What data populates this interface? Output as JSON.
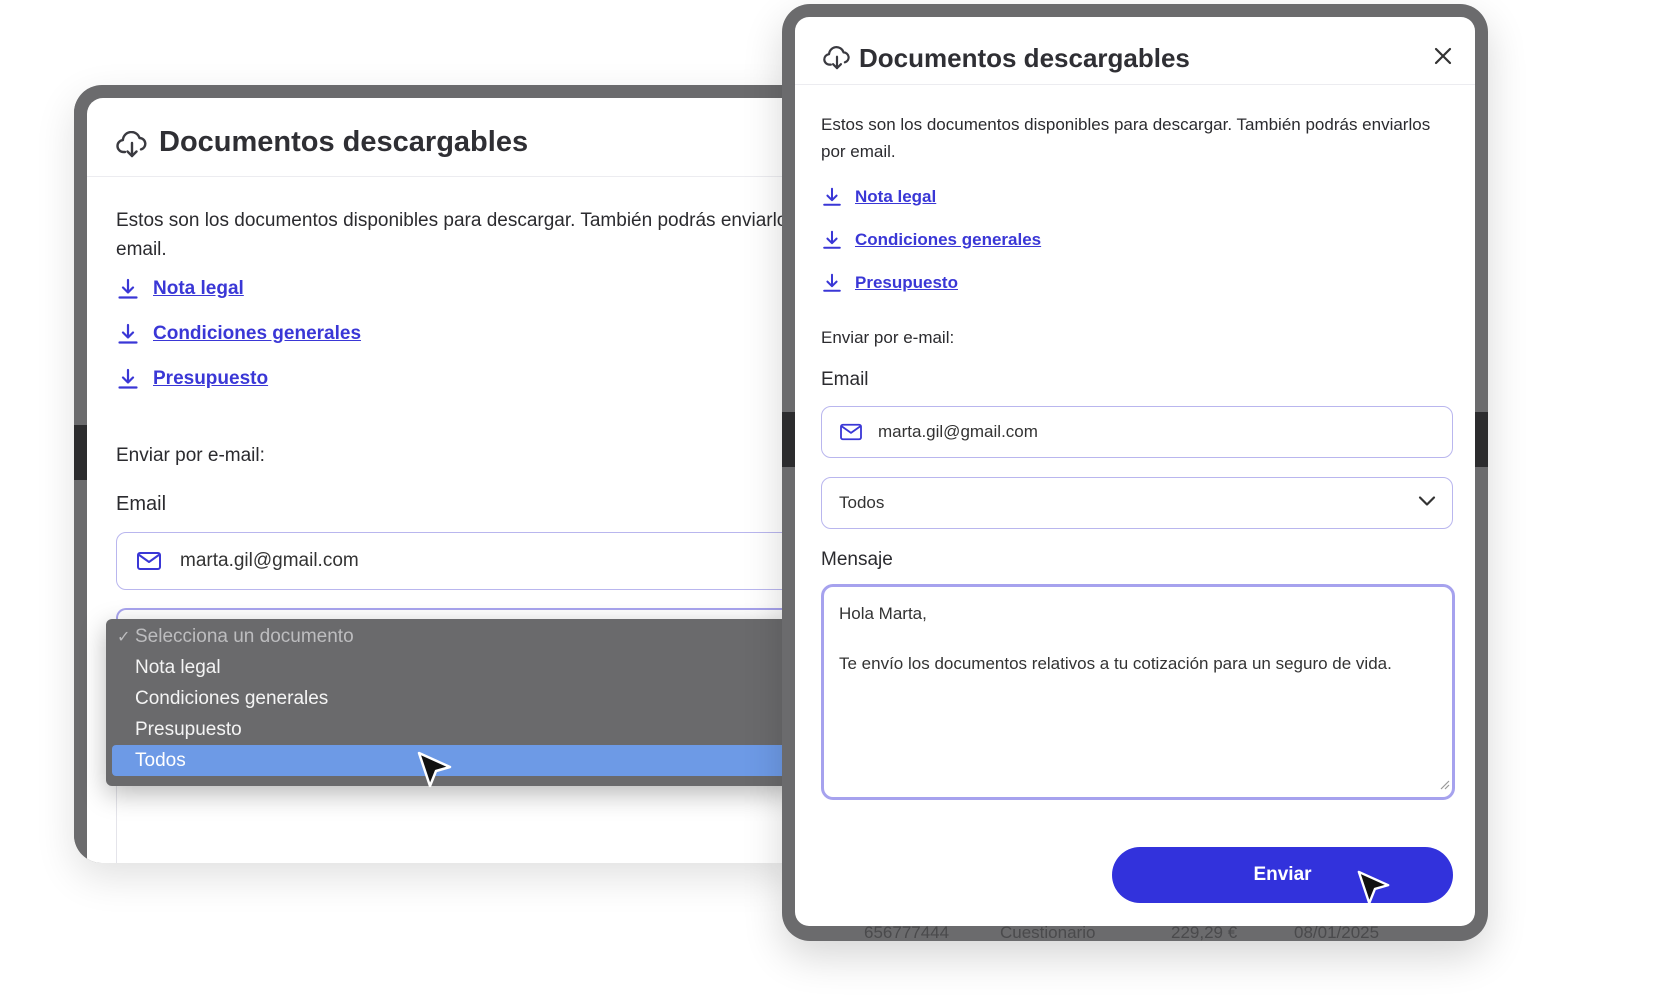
{
  "colors": {
    "accent": "#3232dc",
    "link": "#3a37d6",
    "input_border": "#b9b6ee",
    "dropdown_bg": "#6a6a6c",
    "dropdown_selected": "#6d9ae6"
  },
  "left_modal": {
    "title": "Documentos descargables",
    "title_icon": "cloud-download-icon",
    "description": "Estos son los documentos disponibles para descargar. También podrás enviarlos por email.",
    "documents": [
      {
        "label": "Nota legal",
        "icon": "download-icon"
      },
      {
        "label": "Condiciones generales",
        "icon": "download-icon"
      },
      {
        "label": "Presupuesto",
        "icon": "download-icon"
      }
    ],
    "send_label": "Enviar por e-mail:",
    "email_label": "Email",
    "email_value": "marta.gil@gmail.com",
    "email_icon": "mail-icon",
    "dropdown": {
      "placeholder": "Selecciona un documento",
      "check": "✓",
      "options": [
        "Nota legal",
        "Condiciones generales",
        "Presupuesto",
        "Todos"
      ],
      "selected": "Todos"
    }
  },
  "right_modal": {
    "title": "Documentos descargables",
    "title_icon": "cloud-download-icon",
    "close_icon": "close-icon",
    "description": "Estos son los documentos disponibles para descargar. También podrás enviarlos por email.",
    "documents": [
      {
        "label": "Nota legal",
        "icon": "download-icon"
      },
      {
        "label": "Condiciones generales",
        "icon": "download-icon"
      },
      {
        "label": "Presupuesto",
        "icon": "download-icon"
      }
    ],
    "send_label": "Enviar por e-mail:",
    "email_label": "Email",
    "email_value": "marta.gil@gmail.com",
    "email_icon": "mail-icon",
    "document_select": {
      "value": "Todos",
      "icon": "chevron-down-icon"
    },
    "message_label": "Mensaje",
    "message_lines": [
      "Hola Marta,",
      "Te envío los documentos relativos a tu cotización para un seguro de vida."
    ],
    "submit_label": "Enviar"
  },
  "background_row": {
    "phone": "656777444",
    "status": "Cuestionario",
    "amount": "229,29 €",
    "date": "08/01/2025"
  }
}
